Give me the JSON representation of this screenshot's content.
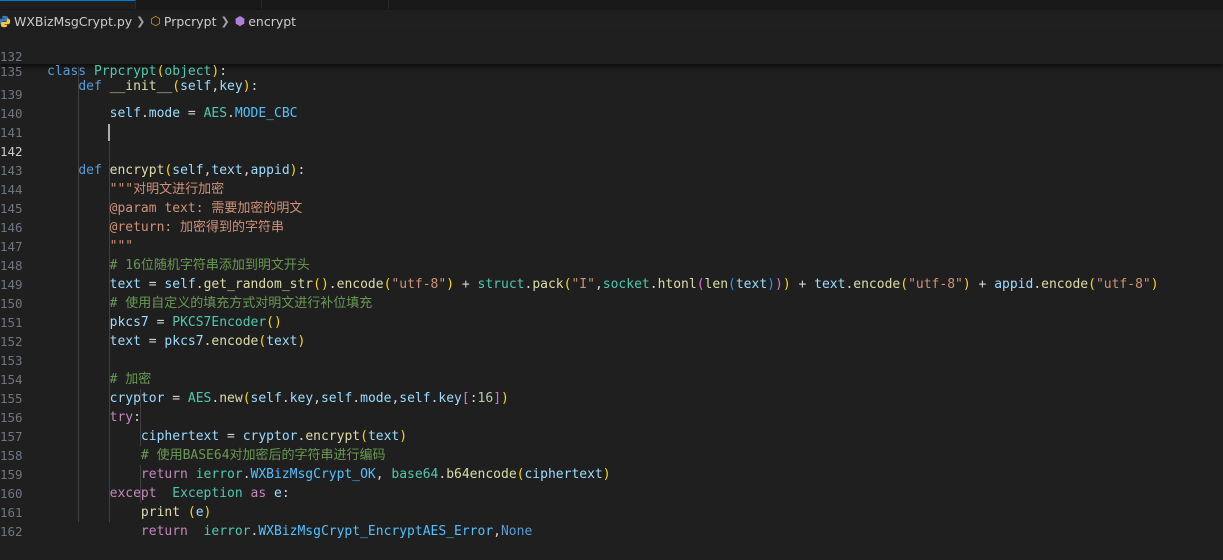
{
  "breadcrumb": {
    "file": "WXBizMsgCrypt.py",
    "class": "Prpcrypt",
    "method": "encrypt"
  },
  "sticky_lines": [
    {
      "num": "132",
      "text": "class Prpcrypt(object):"
    },
    {
      "num": "135",
      "text": "    def __init__(self,key):"
    }
  ],
  "current_line": "142",
  "lines": [
    {
      "num": "139",
      "text": "        self.mode = AES.MODE_CBC"
    },
    {
      "num": "140",
      "text": ""
    },
    {
      "num": "141",
      "text": ""
    },
    {
      "num": "142",
      "text": "    def encrypt(self,text,appid):"
    },
    {
      "num": "143",
      "text": "        \"\"\"对明文进行加密"
    },
    {
      "num": "144",
      "text": "        @param text: 需要加密的明文"
    },
    {
      "num": "145",
      "text": "        @return: 加密得到的字符串"
    },
    {
      "num": "146",
      "text": "        \"\"\""
    },
    {
      "num": "147",
      "text": "        # 16位随机字符串添加到明文开头"
    },
    {
      "num": "148",
      "text": "        text = self.get_random_str().encode(\"utf-8\") + struct.pack(\"I\",socket.htonl(len(text))) + text.encode(\"utf-8\") + appid.encode(\"utf-8\")"
    },
    {
      "num": "149",
      "text": "        # 使用自定义的填充方式对明文进行补位填充"
    },
    {
      "num": "150",
      "text": "        pkcs7 = PKCS7Encoder()"
    },
    {
      "num": "151",
      "text": "        text = pkcs7.encode(text)"
    },
    {
      "num": "152",
      "text": ""
    },
    {
      "num": "153",
      "text": "        # 加密"
    },
    {
      "num": "154",
      "text": "        cryptor = AES.new(self.key,self.mode,self.key[:16])"
    },
    {
      "num": "155",
      "text": "        try:"
    },
    {
      "num": "156",
      "text": "            ciphertext = cryptor.encrypt(text)"
    },
    {
      "num": "157",
      "text": "            # 使用BASE64对加密后的字符串进行编码"
    },
    {
      "num": "158",
      "text": "            return ierror.WXBizMsgCrypt_OK, base64.b64encode(ciphertext)"
    },
    {
      "num": "159",
      "text": "        except  Exception as e:"
    },
    {
      "num": "160",
      "text": "            print (e)"
    },
    {
      "num": "161",
      "text": "            return  ierror.WXBizMsgCrypt_EncryptAES_Error,None"
    },
    {
      "num": "162",
      "text": ""
    }
  ],
  "colors": {
    "background": "#1f1f1f",
    "keyword": "#569cd6",
    "control": "#c586c0",
    "class": "#4ec9b0",
    "function": "#dcdcaa",
    "variable": "#9cdcfe",
    "string": "#ce9178",
    "comment": "#6a9955"
  }
}
